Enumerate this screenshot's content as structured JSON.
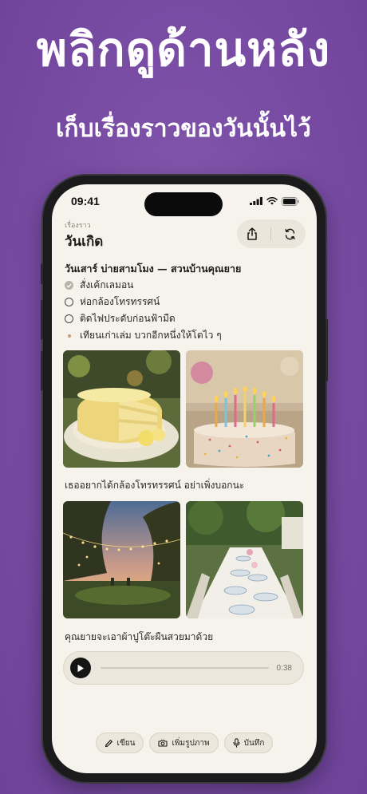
{
  "marketing": {
    "headline": "พลิกดูด้านหลัง",
    "subheadline": "เก็บเรื่องราวของวันนั้นไว้"
  },
  "status_bar": {
    "time": "09:41"
  },
  "header": {
    "eyebrow": "เรื่องราว",
    "title": "วันเกิด",
    "actions": [
      "share-icon",
      "refresh-icon"
    ]
  },
  "note": {
    "heading": "วันเสาร์ บ่ายสามโมง — สวนบ้านคุณยาย",
    "checklist": [
      {
        "label": "สั่งเค้กเลมอน",
        "done": true
      },
      {
        "label": "ห่อกล้องโทรทรรศน์",
        "done": false
      },
      {
        "label": "ติดไฟประดับก่อนฟ้ามืด",
        "done": false
      }
    ],
    "bullets": [
      "เทียนเก่าเล่ม บวกอีกหนึ่งให้โตไว ๆ"
    ]
  },
  "photos_row1": [
    "lemon cake slice",
    "birthday cake with candles"
  ],
  "caption1": "เธออยากได้กล้องโทรทรรศน์ อย่าเพิ่งบอกนะ",
  "photos_row2": [
    "garden string lights at dusk",
    "garden dinner table setting"
  ],
  "caption2": "คุณยายจะเอาผ้าปูโต๊ะผืนสวยมาด้วย",
  "audio": {
    "duration": "0:38",
    "progress": 0
  },
  "toolbar": {
    "write_label": "เขียน",
    "add_photo_label": "เพิ่มรูปภาพ",
    "record_label": "บันทึก"
  },
  "colors": {
    "background": "#7b4ea6",
    "screen": "#f6f3ed",
    "accent": "#141414"
  }
}
